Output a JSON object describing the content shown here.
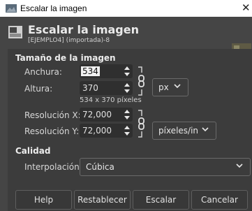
{
  "window": {
    "title": "Escalar la imagen",
    "close_glyph": "✕"
  },
  "header": {
    "title": "Escalar la imagen",
    "subtitle": "[EJEMPLO4] (importada)-8"
  },
  "image_size": {
    "section_title": "Tamaño de la imagen",
    "width_label": "Anchura:",
    "width_value": "534",
    "height_label": "Altura:",
    "height_value": "370",
    "unit": "px",
    "pixel_summary": "534 x 370 píxeles",
    "resx_label": "Resolución X:",
    "resx_value": "72,000",
    "resy_label": "Resolución Y:",
    "resy_value": "72,000",
    "res_unit": "píxeles/in"
  },
  "quality": {
    "section_title": "Calidad",
    "interp_label": "Interpolación:",
    "interp_value": "Cúbica"
  },
  "buttons": {
    "help": "Help",
    "reset": "Restablecer",
    "scale": "Escalar",
    "cancel": "Cancelar"
  }
}
